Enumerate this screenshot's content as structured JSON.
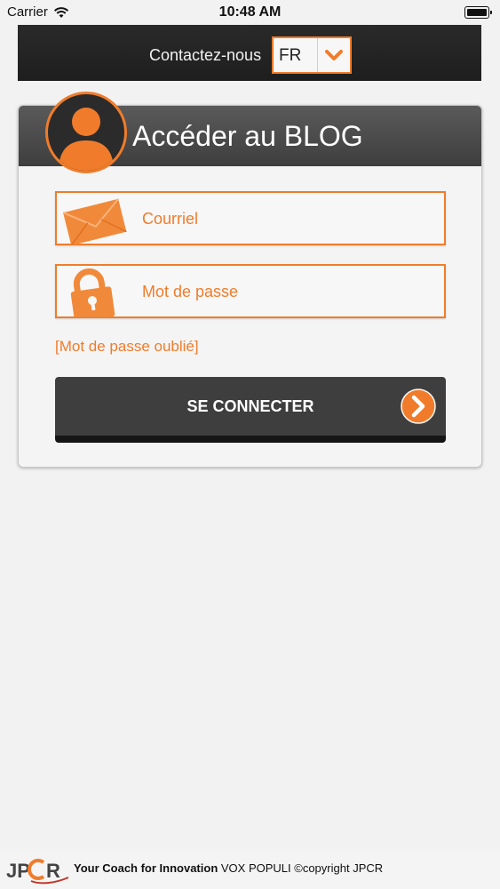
{
  "status_bar": {
    "carrier": "Carrier",
    "time": "10:48 AM"
  },
  "header": {
    "contact_label": "Contactez-nous",
    "language": {
      "selected": "FR"
    }
  },
  "login_card": {
    "title": "Accéder au BLOG",
    "email_placeholder": "Courriel",
    "password_placeholder": "Mot de passe",
    "forgot_password": "[Mot de passe oublié]",
    "submit_label": "SE CONNECTER"
  },
  "footer": {
    "logo_text": "JPCR",
    "tagline": "Your Coach for Innovation",
    "copyright": "VOX POPULI ©copyright JPCR"
  },
  "colors": {
    "accent": "#f07c2b",
    "dark": "#3e3e3e",
    "background": "#f2f2f2"
  },
  "icons": {
    "wifi": "wifi-icon",
    "battery": "battery-icon",
    "chevron": "chevron-down-icon",
    "avatar": "user-avatar-icon",
    "email": "envelope-icon",
    "password": "padlock-icon",
    "arrow": "arrow-right-icon"
  }
}
